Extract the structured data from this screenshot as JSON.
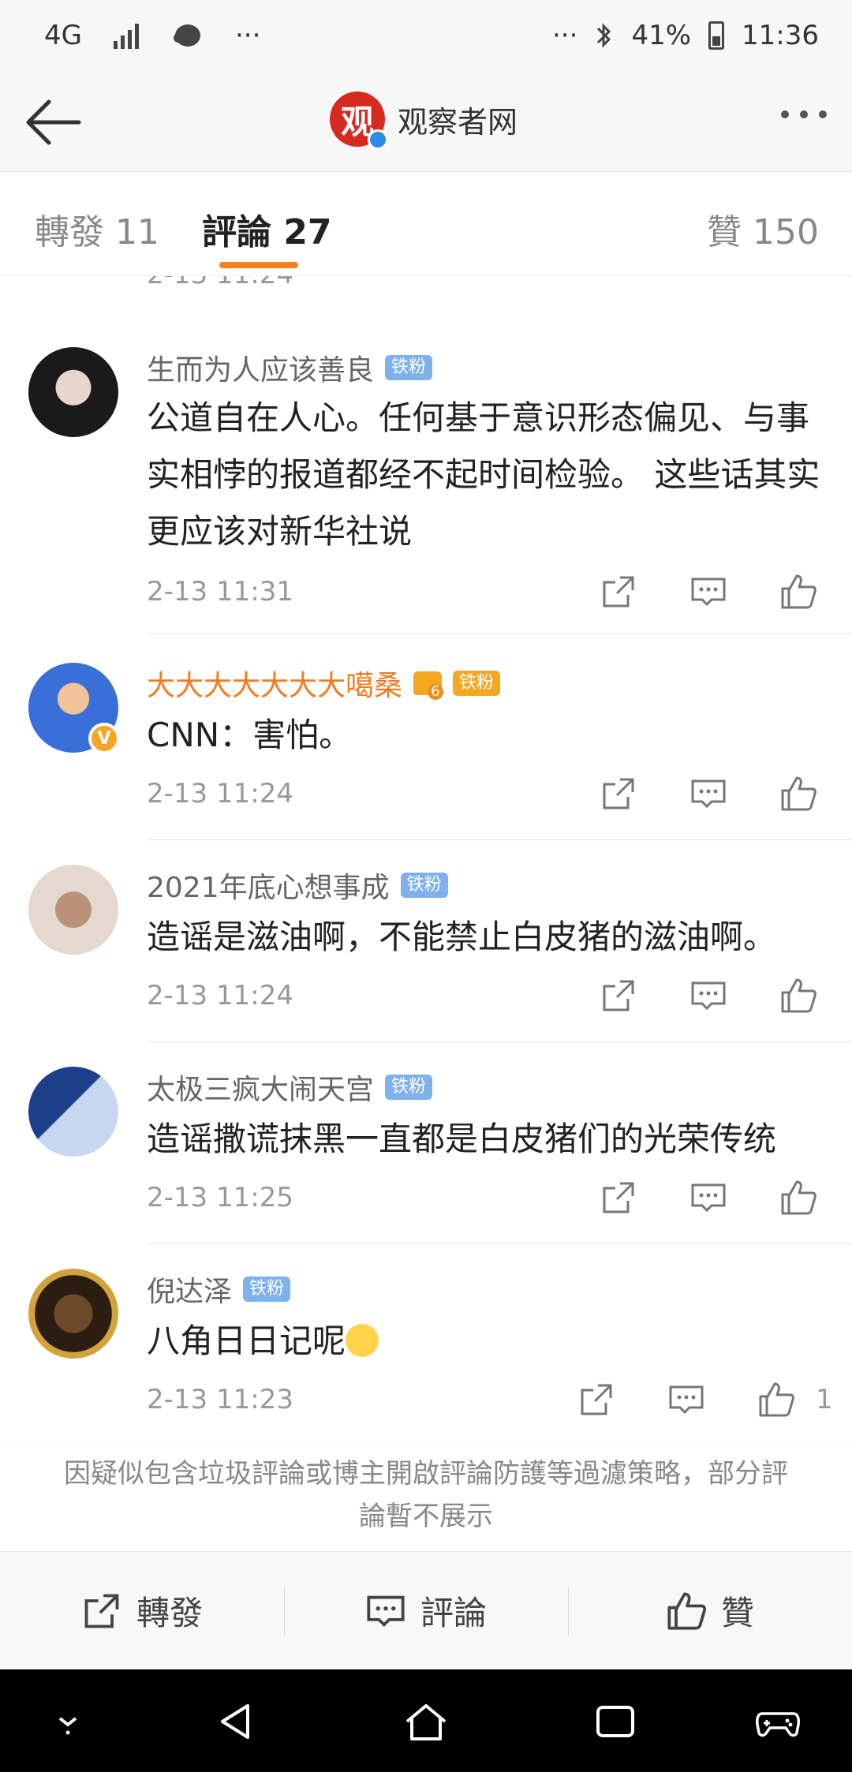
{
  "status_bar": {
    "network": "4G",
    "dots": "···",
    "battery": "41%",
    "time": "11:36"
  },
  "header": {
    "avatar_char": "观",
    "title": "观察者网"
  },
  "tabs": {
    "repost": "轉發 11",
    "comments": "評論 27",
    "likes": "贊 150"
  },
  "partial_time": "2-13 11:24",
  "comments": [
    {
      "user": "生而为人应该善良",
      "badge": "铁粉",
      "text": "公道自在人心。任何基于意识形态偏见、与事实相悖的报道都经不起时间检验。 这些话其实更应该对新华社说",
      "time": "2-13 11:31",
      "likes": ""
    },
    {
      "user": "大大大大大大大噶桑",
      "badge": "铁粉",
      "text": "CNN：害怕。",
      "time": "2-13 11:24",
      "likes": ""
    },
    {
      "user": "2021年底心想事成",
      "badge": "铁粉",
      "text": "造谣是滋油啊，不能禁止白皮猪的滋油啊。",
      "time": "2-13 11:24",
      "likes": ""
    },
    {
      "user": "太极三疯大闹天宫",
      "badge": "铁粉",
      "text": "造谣撒谎抹黑一直都是白皮猪们的光荣传统",
      "time": "2-13 11:25",
      "likes": ""
    },
    {
      "user": "倪达泽",
      "badge": "铁粉",
      "text": "八角日日记呢",
      "time": "2-13 11:23",
      "likes": "1"
    }
  ],
  "notice": "因疑似包含垃圾評論或博主開啟評論防護等過濾策略，部分評論暫不展示",
  "bottom_bar": {
    "repost": "轉發",
    "comment": "評論",
    "like": "贊"
  },
  "colors": {
    "accent": "#f7821b",
    "vip_name": "#f47b20",
    "fan_badge": "#7fb2ec"
  }
}
